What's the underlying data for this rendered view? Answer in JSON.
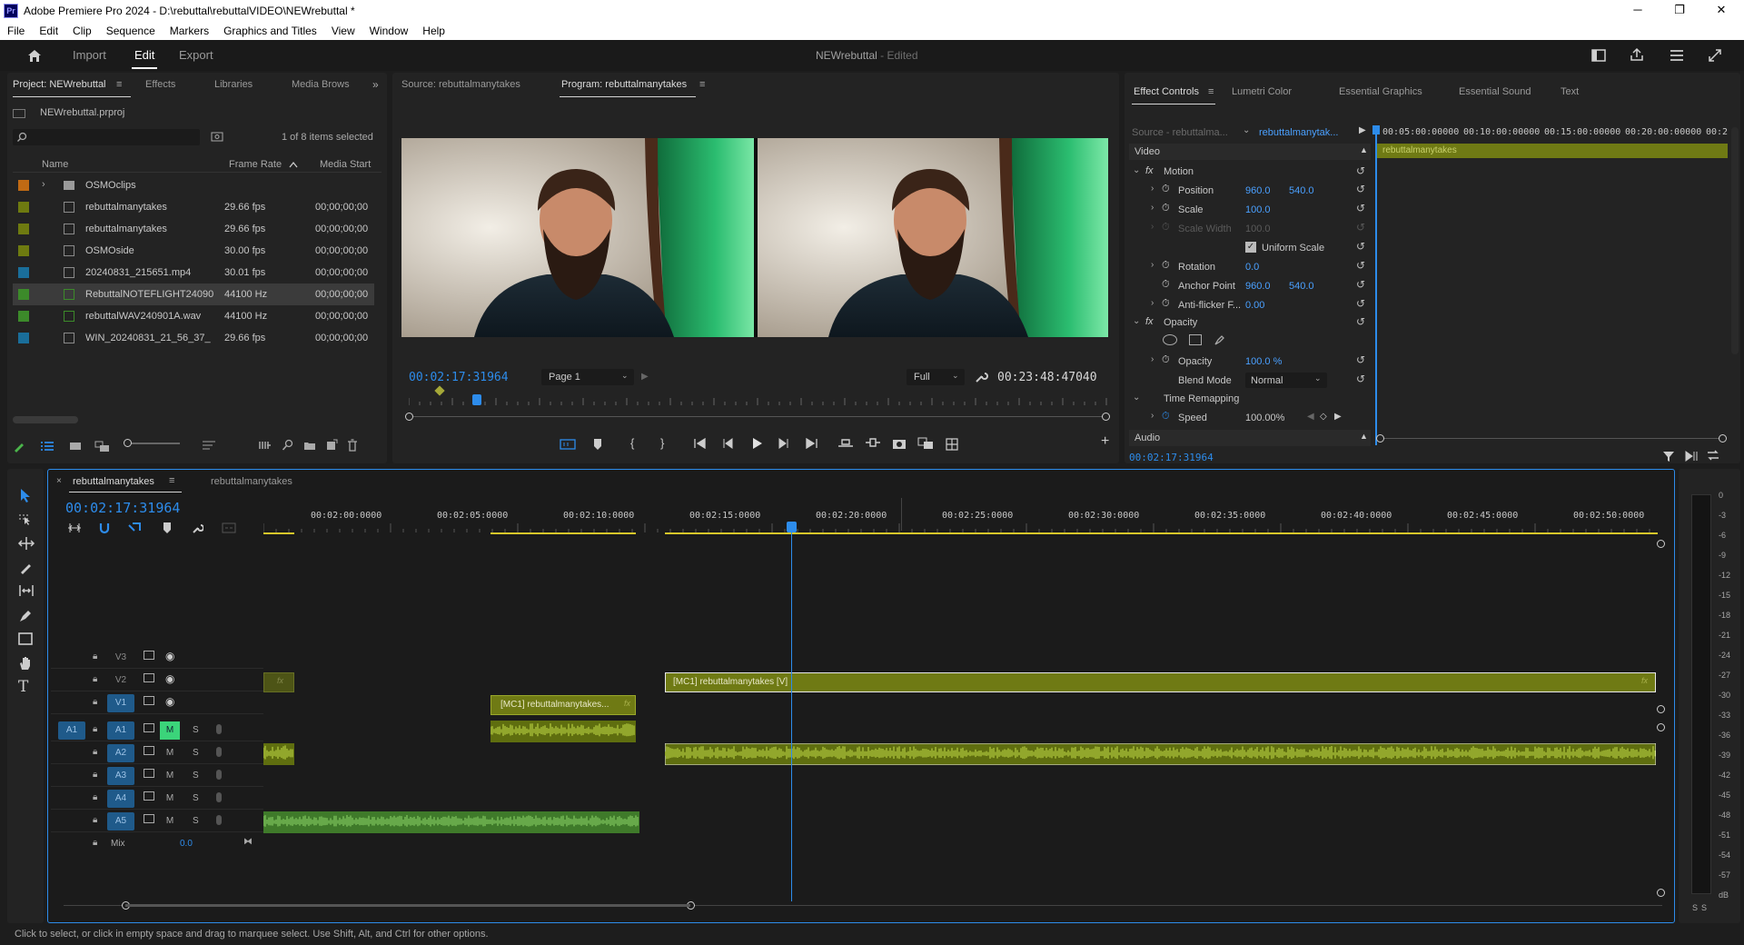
{
  "titlebar": {
    "logo": "Pr",
    "title": "Adobe Premiere Pro 2024 - D:\\rebuttal\\rebuttalVIDEO\\NEWrebuttal *",
    "minimize_icon": "─",
    "restore_icon": "❐",
    "close_icon": "✕"
  },
  "menu": [
    "File",
    "Edit",
    "Clip",
    "Sequence",
    "Markers",
    "Graphics and Titles",
    "View",
    "Window",
    "Help"
  ],
  "workspace": {
    "tabs": [
      "Import",
      "Edit",
      "Export"
    ],
    "active_tab": "Edit",
    "project_name": "NEWrebuttal",
    "project_status": " - Edited"
  },
  "project_panel": {
    "tabs": [
      "Project: NEWrebuttal",
      "Effects",
      "Libraries",
      "Media Brows"
    ],
    "file": "NEWrebuttal.prproj",
    "selection_info": "1 of 8 items selected",
    "columns": [
      "Name",
      "Frame Rate",
      "Media Start"
    ],
    "items": [
      {
        "color": "#c06a14",
        "name": "OSMOclips",
        "rate": "",
        "start": "",
        "type": "folder"
      },
      {
        "color": "#6e7a10",
        "name": "rebuttalmanytakes",
        "rate": "29.66 fps",
        "start": "00;00;00;00",
        "type": "sequence"
      },
      {
        "color": "#6e7a10",
        "name": "rebuttalmanytakes",
        "rate": "29.66 fps",
        "start": "00;00;00;00",
        "type": "multicam"
      },
      {
        "color": "#6e7a10",
        "name": "OSMOside",
        "rate": "30.00 fps",
        "start": "00;00;00;00",
        "type": "multicam"
      },
      {
        "color": "#1a6e9a",
        "name": "20240831_215651.mp4",
        "rate": "30.01 fps",
        "start": "00;00;00;00",
        "type": "video"
      },
      {
        "color": "#3c8a2a",
        "name": "RebuttalNOTEFLIGHT24090",
        "rate": "44100 Hz",
        "start": "00;00;00;00",
        "type": "audio"
      },
      {
        "color": "#3c8a2a",
        "name": "rebuttalWAV240901A.wav",
        "rate": "44100 Hz",
        "start": "00;00;00;00",
        "type": "audio"
      },
      {
        "color": "#1a6e9a",
        "name": "WIN_20240831_21_56_37_",
        "rate": "29.66 fps",
        "start": "00;00;00;00",
        "type": "video"
      }
    ],
    "selected_index": 5
  },
  "monitor": {
    "source_tab": "Source: rebuttalmanytakes",
    "program_tab": "Program: rebuttalmanytakes",
    "current_time": "00:02:17:31964",
    "page": "Page 1",
    "quality": "Full",
    "duration": "00:23:48:47040",
    "playhead_fraction": 0.098
  },
  "effect_controls": {
    "tabs": [
      "Effect Controls",
      "Lumetri Color",
      "Essential Graphics",
      "Essential Sound",
      "Text"
    ],
    "source": "Source - rebuttalma...",
    "sequence": "rebuttalmanytak...",
    "ruler": [
      "00:05:00:00000",
      "00:10:00:00000",
      "00:15:00:00000",
      "00:20:00:00000",
      "00:2"
    ],
    "clip_name": "rebuttalmanytakes",
    "video_label": "Video",
    "motion": "Motion",
    "position": {
      "label": "Position",
      "x": "960.0",
      "y": "540.0"
    },
    "scale": {
      "label": "Scale",
      "value": "100.0"
    },
    "scale_width": {
      "label": "Scale Width",
      "value": "100.0"
    },
    "uniform_scale": "Uniform Scale",
    "rotation": {
      "label": "Rotation",
      "value": "0.0"
    },
    "anchor": {
      "label": "Anchor Point",
      "x": "960.0",
      "y": "540.0"
    },
    "antiflicker": {
      "label": "Anti-flicker F...",
      "value": "0.00"
    },
    "opacity_group": "Opacity",
    "opacity": {
      "label": "Opacity",
      "value": "100.0 %"
    },
    "blend": {
      "label": "Blend Mode",
      "value": "Normal"
    },
    "time_remap": "Time Remapping",
    "speed": {
      "label": "Speed",
      "value": "100.00%"
    },
    "audio_label": "Audio",
    "footer_time": "00:02:17:31964"
  },
  "timeline": {
    "tabs": [
      "rebuttalmanytakes",
      "rebuttalmanytakes"
    ],
    "timecode": "00:02:17:31964",
    "ruler": [
      "00:02:00:0000",
      "00:02:05:0000",
      "00:02:10:0000",
      "00:02:15:0000",
      "00:02:20:0000",
      "00:02:25:0000",
      "00:02:30:0000",
      "00:02:35:0000",
      "00:02:40:0000",
      "00:02:45:0000",
      "00:02:50:0000"
    ],
    "video_tracks": [
      "V3",
      "V2",
      "V1"
    ],
    "audio_tracks": [
      "A1",
      "A2",
      "A3",
      "A4",
      "A5"
    ],
    "source_patch": "A1",
    "mix_label": "Mix",
    "mix_value": "0.0",
    "clip_v2": "[MC1] rebuttalmanytakes [V]",
    "clip_v1": "[MC1] rebuttalmanytakes...",
    "fx_label": "fx",
    "m_label": "M",
    "s_label": "S"
  },
  "meter": {
    "scale": [
      "0",
      "-3",
      "-6",
      "-9",
      "-12",
      "-15",
      "-18",
      "-21",
      "-24",
      "-27",
      "-30",
      "-33",
      "-36",
      "-39",
      "-42",
      "-45",
      "-48",
      "-51",
      "-54",
      "-57",
      "dB"
    ],
    "solo_labels": [
      "S",
      "S"
    ]
  },
  "status": "Click to select, or click in empty space and drag to marquee select. Use Shift, Alt, and Ctrl for other options.",
  "colors": {
    "accent": "#2d8ceb",
    "video_clip": "#6f7a14",
    "audio_wave": "#c6e04a",
    "playhead": "#2d8ceb"
  }
}
